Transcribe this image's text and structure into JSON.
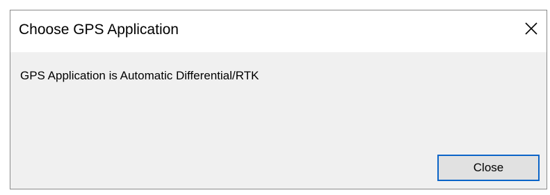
{
  "dialog": {
    "title": "Choose GPS Application",
    "message": "GPS Application is Automatic Differential/RTK",
    "close_button_label": "Close",
    "title_close_icon": "close-icon",
    "accent_color": "#0a64c8"
  }
}
